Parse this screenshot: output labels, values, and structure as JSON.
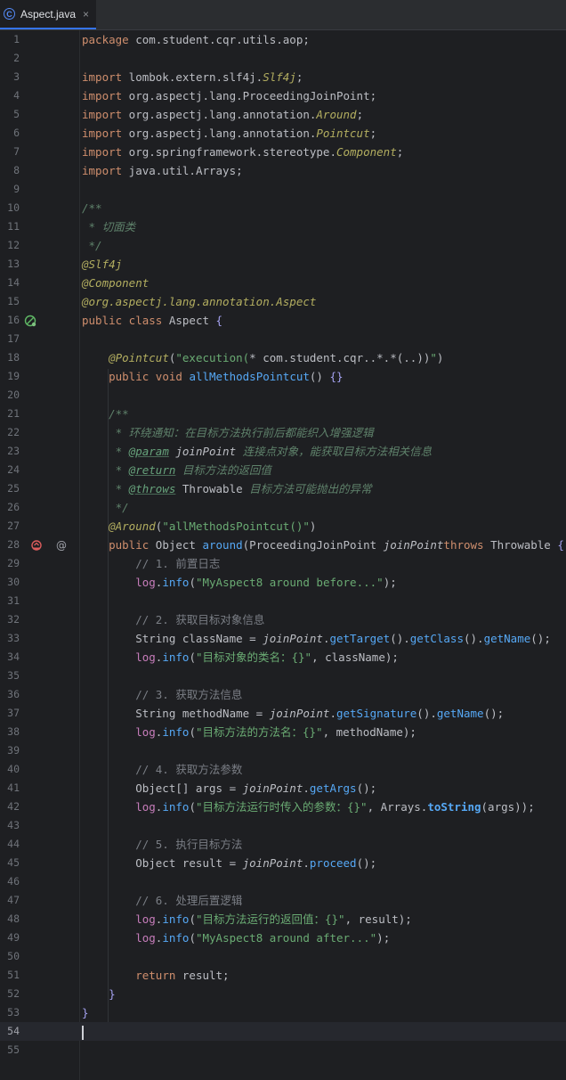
{
  "tab": {
    "title": "Aspect.java",
    "icon": "java-class-icon",
    "close": "×"
  },
  "current_line": 54,
  "lines": [
    {
      "n": "1",
      "t": [
        [
          "kw",
          "package"
        ],
        [
          "",
          " com.student.cqr.utils.aop;"
        ]
      ]
    },
    {
      "n": "2",
      "t": []
    },
    {
      "n": "3",
      "t": [
        [
          "kw",
          "import"
        ],
        [
          "",
          " lombok.extern.slf4j."
        ],
        [
          "it-ann",
          "Slf4j"
        ],
        [
          "",
          ";"
        ]
      ]
    },
    {
      "n": "4",
      "t": [
        [
          "kw",
          "import"
        ],
        [
          "",
          " org.aspectj.lang.ProceedingJoinPoint;"
        ]
      ]
    },
    {
      "n": "5",
      "t": [
        [
          "kw",
          "import"
        ],
        [
          "",
          " org.aspectj.lang.annotation."
        ],
        [
          "it-ann",
          "Around"
        ],
        [
          "",
          ";"
        ]
      ]
    },
    {
      "n": "6",
      "t": [
        [
          "kw",
          "import"
        ],
        [
          "",
          " org.aspectj.lang.annotation."
        ],
        [
          "it-ann",
          "Pointcut"
        ],
        [
          "",
          ";"
        ]
      ]
    },
    {
      "n": "7",
      "t": [
        [
          "kw",
          "import"
        ],
        [
          "",
          " org.springframework.stereotype."
        ],
        [
          "it-ann",
          "Component"
        ],
        [
          "",
          ";"
        ]
      ]
    },
    {
      "n": "8",
      "t": [
        [
          "kw",
          "import"
        ],
        [
          "",
          " java.util.Arrays;"
        ]
      ]
    },
    {
      "n": "9",
      "t": []
    },
    {
      "n": "10",
      "t": [
        [
          "doc",
          "/**"
        ]
      ]
    },
    {
      "n": "11",
      "t": [
        [
          "doc",
          " * 切面类"
        ]
      ]
    },
    {
      "n": "12",
      "t": [
        [
          "doc",
          " */"
        ]
      ]
    },
    {
      "n": "13",
      "t": [
        [
          "it-ann",
          "@Slf4j"
        ]
      ]
    },
    {
      "n": "14",
      "t": [
        [
          "it-ann",
          "@Component"
        ]
      ]
    },
    {
      "n": "15",
      "t": [
        [
          "it-ann",
          "@org.aspectj.lang.annotation.Aspect"
        ]
      ]
    },
    {
      "n": "16",
      "t": [
        [
          "kw",
          "public class"
        ],
        [
          "",
          " Aspect "
        ],
        [
          "br",
          "{"
        ]
      ]
    },
    {
      "n": "17",
      "t": []
    },
    {
      "n": "18",
      "t": [
        [
          "",
          "    "
        ],
        [
          "it-ann",
          "@Pointcut"
        ],
        [
          "",
          "("
        ],
        [
          "str",
          "\"execution("
        ],
        [
          "",
          "* com.student.cqr..*.*(..))"
        ],
        [
          "str",
          "\""
        ],
        [
          "",
          ")"
        ]
      ]
    },
    {
      "n": "19",
      "t": [
        [
          "",
          "    "
        ],
        [
          "kw",
          "public void"
        ],
        [
          "",
          " "
        ],
        [
          "fn",
          "allMethodsPointcut"
        ],
        [
          "",
          "() "
        ],
        [
          "br",
          "{}"
        ]
      ]
    },
    {
      "n": "20",
      "t": []
    },
    {
      "n": "21",
      "t": [
        [
          "doc",
          "    /**"
        ]
      ]
    },
    {
      "n": "22",
      "t": [
        [
          "doc",
          "     * 环绕通知：在目标方法执行前后都能织入增强逻辑"
        ]
      ]
    },
    {
      "n": "23",
      "t": [
        [
          "doc",
          "     * "
        ],
        [
          "doctag",
          "@param"
        ],
        [
          "doc",
          " "
        ],
        [
          "par",
          "joinPoint"
        ],
        [
          "doc",
          " 连接点对象，能获取目标方法相关信息"
        ]
      ]
    },
    {
      "n": "24",
      "t": [
        [
          "doc",
          "     * "
        ],
        [
          "doctag",
          "@return"
        ],
        [
          "doc",
          " 目标方法的返回值"
        ]
      ]
    },
    {
      "n": "25",
      "t": [
        [
          "doc",
          "     * "
        ],
        [
          "doctag",
          "@throws"
        ],
        [
          "doc",
          " "
        ],
        [
          "cls",
          "Throwable"
        ],
        [
          "doc",
          " 目标方法可能抛出的异常"
        ]
      ]
    },
    {
      "n": "26",
      "t": [
        [
          "doc",
          "     */"
        ]
      ]
    },
    {
      "n": "27",
      "t": [
        [
          "",
          "    "
        ],
        [
          "it-ann",
          "@Around"
        ],
        [
          "",
          "("
        ],
        [
          "str",
          "\"allMethodsPointcut()\""
        ],
        [
          "",
          ")"
        ]
      ]
    },
    {
      "n": "28",
      "t": [
        [
          "",
          "    "
        ],
        [
          "kw",
          "public"
        ],
        [
          "",
          " Object "
        ],
        [
          "fn",
          "around"
        ],
        [
          "",
          "(ProceedingJoinPoint "
        ],
        [
          "par",
          "joinPoint"
        ],
        [
          ") "
        ],
        [
          "kw",
          "throws"
        ],
        [
          "",
          " Throwable "
        ],
        [
          "br",
          "{"
        ]
      ]
    },
    {
      "n": "29",
      "t": [
        [
          "cm",
          "        // 1. 前置日志"
        ]
      ]
    },
    {
      "n": "30",
      "t": [
        [
          "",
          "        "
        ],
        [
          "fld",
          "log"
        ],
        [
          "",
          "."
        ],
        [
          "fn",
          "info"
        ],
        [
          "",
          "("
        ],
        [
          "str",
          "\"MyAspect8 around before...\""
        ],
        [
          "",
          ");"
        ]
      ]
    },
    {
      "n": "31",
      "t": []
    },
    {
      "n": "32",
      "t": [
        [
          "cm",
          "        // 2. 获取目标对象信息"
        ]
      ]
    },
    {
      "n": "33",
      "t": [
        [
          "",
          "        String className = "
        ],
        [
          "par",
          "joinPoint"
        ],
        [
          "",
          "."
        ],
        [
          "fn",
          "getTarget"
        ],
        [
          "",
          "()."
        ],
        [
          "fn",
          "getClass"
        ],
        [
          "",
          "()."
        ],
        [
          "fn",
          "getName"
        ],
        [
          "",
          "();"
        ]
      ]
    },
    {
      "n": "34",
      "t": [
        [
          "",
          "        "
        ],
        [
          "fld",
          "log"
        ],
        [
          "",
          "."
        ],
        [
          "fn",
          "info"
        ],
        [
          "",
          "("
        ],
        [
          "str",
          "\"目标对象的类名：{}\""
        ],
        [
          "",
          ", className);"
        ]
      ]
    },
    {
      "n": "35",
      "t": []
    },
    {
      "n": "36",
      "t": [
        [
          "cm",
          "        // 3. 获取方法信息"
        ]
      ]
    },
    {
      "n": "37",
      "t": [
        [
          "",
          "        String methodName = "
        ],
        [
          "par",
          "joinPoint"
        ],
        [
          "",
          "."
        ],
        [
          "fn",
          "getSignature"
        ],
        [
          "",
          "()."
        ],
        [
          "fn",
          "getName"
        ],
        [
          "",
          "();"
        ]
      ]
    },
    {
      "n": "38",
      "t": [
        [
          "",
          "        "
        ],
        [
          "fld",
          "log"
        ],
        [
          "",
          "."
        ],
        [
          "fn",
          "info"
        ],
        [
          "",
          "("
        ],
        [
          "str",
          "\"目标方法的方法名：{}\""
        ],
        [
          "",
          ", methodName);"
        ]
      ]
    },
    {
      "n": "39",
      "t": []
    },
    {
      "n": "40",
      "t": [
        [
          "cm",
          "        // 4. 获取方法参数"
        ]
      ]
    },
    {
      "n": "41",
      "t": [
        [
          "",
          "        Object[] args = "
        ],
        [
          "par",
          "joinPoint"
        ],
        [
          "",
          "."
        ],
        [
          "fn",
          "getArgs"
        ],
        [
          "",
          "();"
        ]
      ]
    },
    {
      "n": "42",
      "t": [
        [
          "",
          "        "
        ],
        [
          "fld",
          "log"
        ],
        [
          "",
          "."
        ],
        [
          "fn",
          "info"
        ],
        [
          "",
          "("
        ],
        [
          "str",
          "\"目标方法运行时传入的参数：{}\""
        ],
        [
          "",
          ", Arrays."
        ],
        [
          "st",
          "toString"
        ],
        [
          "",
          "(args));"
        ]
      ]
    },
    {
      "n": "43",
      "t": []
    },
    {
      "n": "44",
      "t": [
        [
          "cm",
          "        // 5. 执行目标方法"
        ]
      ]
    },
    {
      "n": "45",
      "t": [
        [
          "",
          "        Object result = "
        ],
        [
          "par",
          "joinPoint"
        ],
        [
          "",
          "."
        ],
        [
          "fn",
          "proceed"
        ],
        [
          "",
          "();"
        ]
      ]
    },
    {
      "n": "46",
      "t": []
    },
    {
      "n": "47",
      "t": [
        [
          "cm",
          "        // 6. 处理后置逻辑"
        ]
      ]
    },
    {
      "n": "48",
      "t": [
        [
          "",
          "        "
        ],
        [
          "fld",
          "log"
        ],
        [
          "",
          "."
        ],
        [
          "fn",
          "info"
        ],
        [
          "",
          "("
        ],
        [
          "str",
          "\"目标方法运行的返回值：{}\""
        ],
        [
          "",
          ", result);"
        ]
      ]
    },
    {
      "n": "49",
      "t": [
        [
          "",
          "        "
        ],
        [
          "fld",
          "log"
        ],
        [
          "",
          "."
        ],
        [
          "fn",
          "info"
        ],
        [
          "",
          "("
        ],
        [
          "str",
          "\"MyAspect8 around after...\""
        ],
        [
          "",
          ");"
        ]
      ]
    },
    {
      "n": "50",
      "t": []
    },
    {
      "n": "51",
      "t": [
        [
          "",
          "        "
        ],
        [
          "kw",
          "return"
        ],
        [
          "",
          " result;"
        ]
      ]
    },
    {
      "n": "52",
      "t": [
        [
          "",
          "    "
        ],
        [
          "br",
          "}"
        ]
      ]
    },
    {
      "n": "53",
      "t": [
        [
          "br",
          "}"
        ]
      ]
    },
    {
      "n": "54",
      "t": []
    },
    {
      "n": "55",
      "t": []
    }
  ],
  "gutter_icons": [
    {
      "line": 16,
      "name": "spring-bean-icon"
    },
    {
      "line": 28,
      "name": "aop-advice-icon"
    },
    {
      "line": 28,
      "name": "at-annotation-icon"
    }
  ],
  "colors": {
    "background": "#1e1f22",
    "keyword": "#cf8e6d",
    "annotation": "#b3ae60",
    "string": "#6aab73",
    "comment": "#7a7e85",
    "function": "#56a8f5",
    "field": "#c77dbb"
  }
}
